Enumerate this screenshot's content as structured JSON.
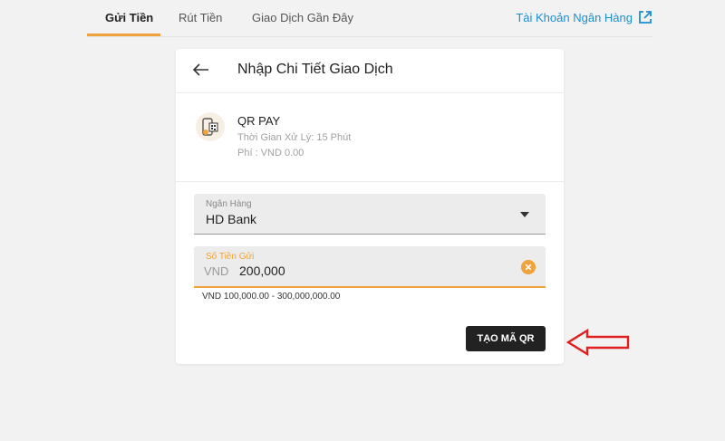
{
  "tabs": [
    {
      "label": "Gửi Tiền",
      "active": true
    },
    {
      "label": "Rút Tiền",
      "active": false
    },
    {
      "label": "Giao Dịch Gần Đây",
      "active": false
    }
  ],
  "bank_link": {
    "label": "Tài Khoản Ngân Hàng",
    "icon": "external-link-icon"
  },
  "card": {
    "title": "Nhập Chi Tiết Giao Dịch",
    "back_icon": "back-arrow-icon",
    "method": {
      "name": "QR PAY",
      "processing_time": "Thời Gian Xử Lý: 15 Phút",
      "fee": "Phí : VND 0.00",
      "icon": "qr-pay-icon"
    },
    "bank_field": {
      "label": "Ngân Hàng",
      "value": "HD Bank"
    },
    "amount_field": {
      "label": "Số Tiền Gửi",
      "currency": "VND",
      "value": "200,000",
      "range_hint": "VND 100,000.00 - 300,000,000.00"
    },
    "submit_label": "TẠO MÃ QR"
  },
  "colors": {
    "accent": "#f0a33a",
    "link": "#1a8fd1",
    "button": "#222222",
    "annotation_arrow": "#e02020"
  }
}
